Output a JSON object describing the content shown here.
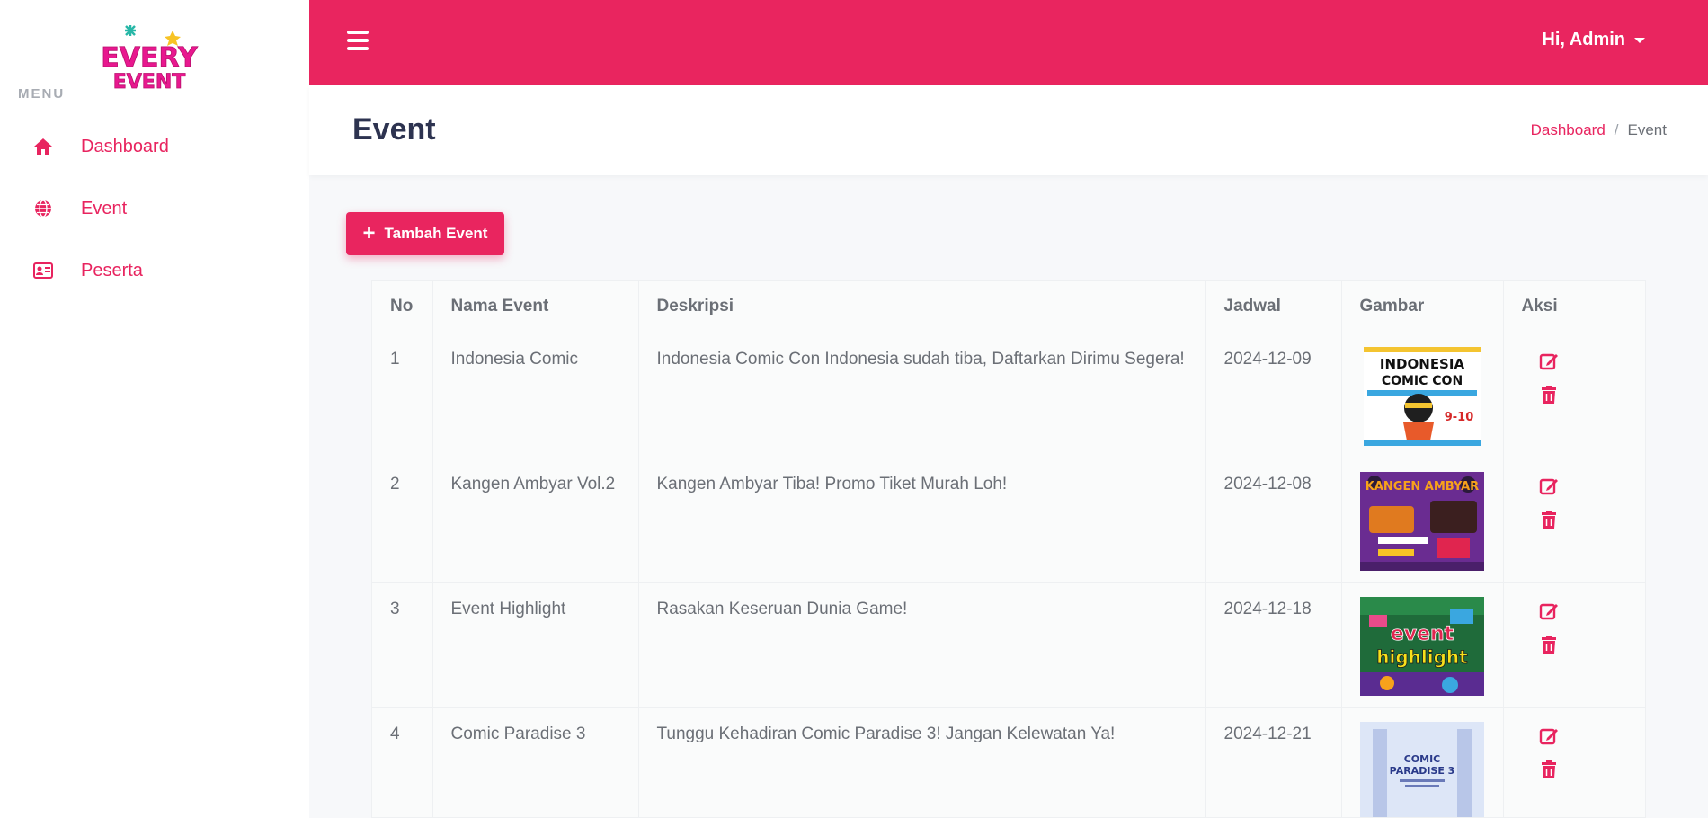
{
  "brand": {
    "logo_line1": "EVERY",
    "logo_line2": "EVENT"
  },
  "sidebar": {
    "menu_label": "MENU",
    "items": [
      {
        "label": "Dashboard",
        "icon": "home-icon"
      },
      {
        "label": "Event",
        "icon": "globe-icon"
      },
      {
        "label": "Peserta",
        "icon": "id-card-icon"
      }
    ]
  },
  "topbar": {
    "user_greeting": "Hi, Admin"
  },
  "header": {
    "title": "Event",
    "breadcrumb": {
      "link": "Dashboard",
      "separator": "/",
      "current": "Event"
    }
  },
  "actions": {
    "add_label": "Tambah Event"
  },
  "table": {
    "columns": [
      "No",
      "Nama Event",
      "Deskripsi",
      "Jadwal",
      "Gambar",
      "Aksi"
    ],
    "rows": [
      {
        "no": "1",
        "name": "Indonesia Comic",
        "desc": "Indonesia Comic Con Indonesia sudah tiba, Daftarkan Dirimu Segera!",
        "date": "2024-12-09",
        "img": "INDONESIA COMIC CON",
        "img_sub": "9-10"
      },
      {
        "no": "2",
        "name": "Kangen Ambyar Vol.2",
        "desc": "Kangen Ambyar Tiba! Promo Tiket Murah Loh!",
        "date": "2024-12-08",
        "img": "KANGEN AMBYAR",
        "img_sub": ""
      },
      {
        "no": "3",
        "name": "Event Highlight",
        "desc": "Rasakan Keseruan Dunia Game!",
        "date": "2024-12-18",
        "img": "event highlight",
        "img_sub": ""
      },
      {
        "no": "4",
        "name": "Comic Paradise 3",
        "desc": "Tunggu Kehadiran Comic Paradise 3! Jangan Kelewatan Ya!",
        "date": "2024-12-21",
        "img": "COMIC PARADISE 3",
        "img_sub": ""
      }
    ]
  },
  "colors": {
    "accent": "#e9255f",
    "heading": "#2d3350",
    "text": "#6b6f76"
  }
}
